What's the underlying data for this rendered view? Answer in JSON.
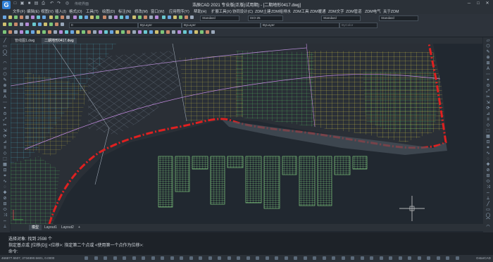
{
  "app": {
    "title": "浩辰CAD 2021 专业版(正版)试用期) - [二期地形0417.dwg]",
    "logo_letter": "G",
    "workspace": "传统界面"
  },
  "menu": [
    "文件(F)",
    "编辑(E)",
    "视图(V)",
    "插入(I)",
    "格式(O)",
    "工具(T)",
    "绘图(D)",
    "标注(N)",
    "修改(M)",
    "窗口(W)",
    "应用程序(Y)",
    "帮助(H)",
    "扩展工具(X)",
    "协同设计(C)",
    "ZDM土建",
    "ZDM给排水",
    "ZDM工具",
    "ZDM暖通",
    "ZDM文字",
    "ZDM管道",
    "ZDM电气",
    "关于ZDM"
  ],
  "toolbar": {
    "text_style": "Standard",
    "dim_style": "ISO-25",
    "table_style": "Standard",
    "multileader_style": "Standard",
    "layer_value": "0",
    "color_value": "ByLayer",
    "linetype_value": "ByLayer",
    "lineweight_value": "ByLayer",
    "plot_style": "ByColor"
  },
  "file_tabs": [
    "管线图1.dwg",
    "二期地形0417.dwg"
  ],
  "layout_tabs": [
    "模型",
    "Layout1",
    "Layout2",
    "+"
  ],
  "command": {
    "lines": [
      "选择对象: 找到 2598 个",
      "指定基点或 [位移(D)] <位移>:   指定第二个点或 <使用第一个点作为位移>:",
      "命令:"
    ]
  },
  "status": {
    "coords": "466877.5507, 2734890.5601, 0.0000",
    "brand": "GstarCAD"
  },
  "colors": {
    "boundary": "#e02020",
    "land_grid_yellow": "#e8d84a",
    "land_grid_green": "#5bd26a",
    "road_cyan": "#4fc7e0",
    "accent": "#2f7fd6"
  },
  "icons": [
    "undo-icon",
    "redo-icon",
    "save-icon",
    "open-icon",
    "new-icon",
    "print-icon",
    "layer-icon",
    "zoom-icon",
    "pan-icon"
  ]
}
